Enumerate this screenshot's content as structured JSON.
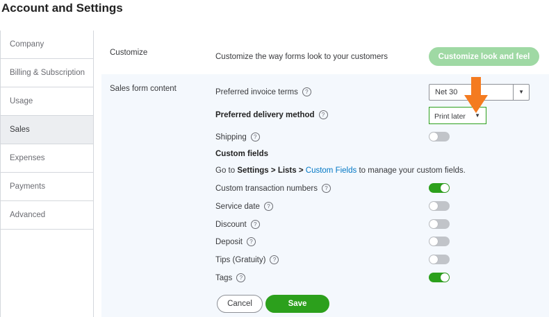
{
  "page_title": "Account and Settings",
  "sidebar": {
    "items": [
      {
        "label": "Company",
        "active": false
      },
      {
        "label": "Billing & Subscription",
        "active": false
      },
      {
        "label": "Usage",
        "active": false
      },
      {
        "label": "Sales",
        "active": true
      },
      {
        "label": "Expenses",
        "active": false
      },
      {
        "label": "Payments",
        "active": false
      },
      {
        "label": "Advanced",
        "active": false
      }
    ]
  },
  "customize": {
    "label": "Customize",
    "description": "Customize the way forms look to your customers",
    "button_label": "Customize look and feel"
  },
  "sales_form_content": {
    "label": "Sales form content",
    "preferred_invoice_terms": {
      "label": "Preferred invoice terms",
      "value": "Net 30"
    },
    "preferred_delivery_method": {
      "label": "Preferred delivery method",
      "value": "Print later"
    },
    "shipping": {
      "label": "Shipping",
      "on": false
    },
    "custom_fields_heading": "Custom fields",
    "custom_fields_line": {
      "prefix": "Go to ",
      "settings": "Settings",
      "arrow1": " > ",
      "lists": "Lists",
      "arrow2": " > ",
      "link": "Custom Fields",
      "suffix": " to manage your custom fields."
    },
    "custom_transaction_numbers": {
      "label": "Custom transaction numbers",
      "on": true
    },
    "service_date": {
      "label": "Service date",
      "on": false
    },
    "discount": {
      "label": "Discount",
      "on": false
    },
    "deposit": {
      "label": "Deposit",
      "on": false
    },
    "tips": {
      "label": "Tips (Gratuity)",
      "on": false
    },
    "tags": {
      "label": "Tags",
      "on": true
    }
  },
  "buttons": {
    "cancel": "Cancel",
    "save": "Save"
  },
  "icons": {
    "help": "help-circle-icon",
    "caret": "caret-down-icon",
    "annotation": "orange-arrow-icon"
  },
  "colors": {
    "accent": "#2ca01c",
    "accent_light": "#9fd9a4",
    "link": "#0077c5",
    "annotation": "#f47b20"
  }
}
